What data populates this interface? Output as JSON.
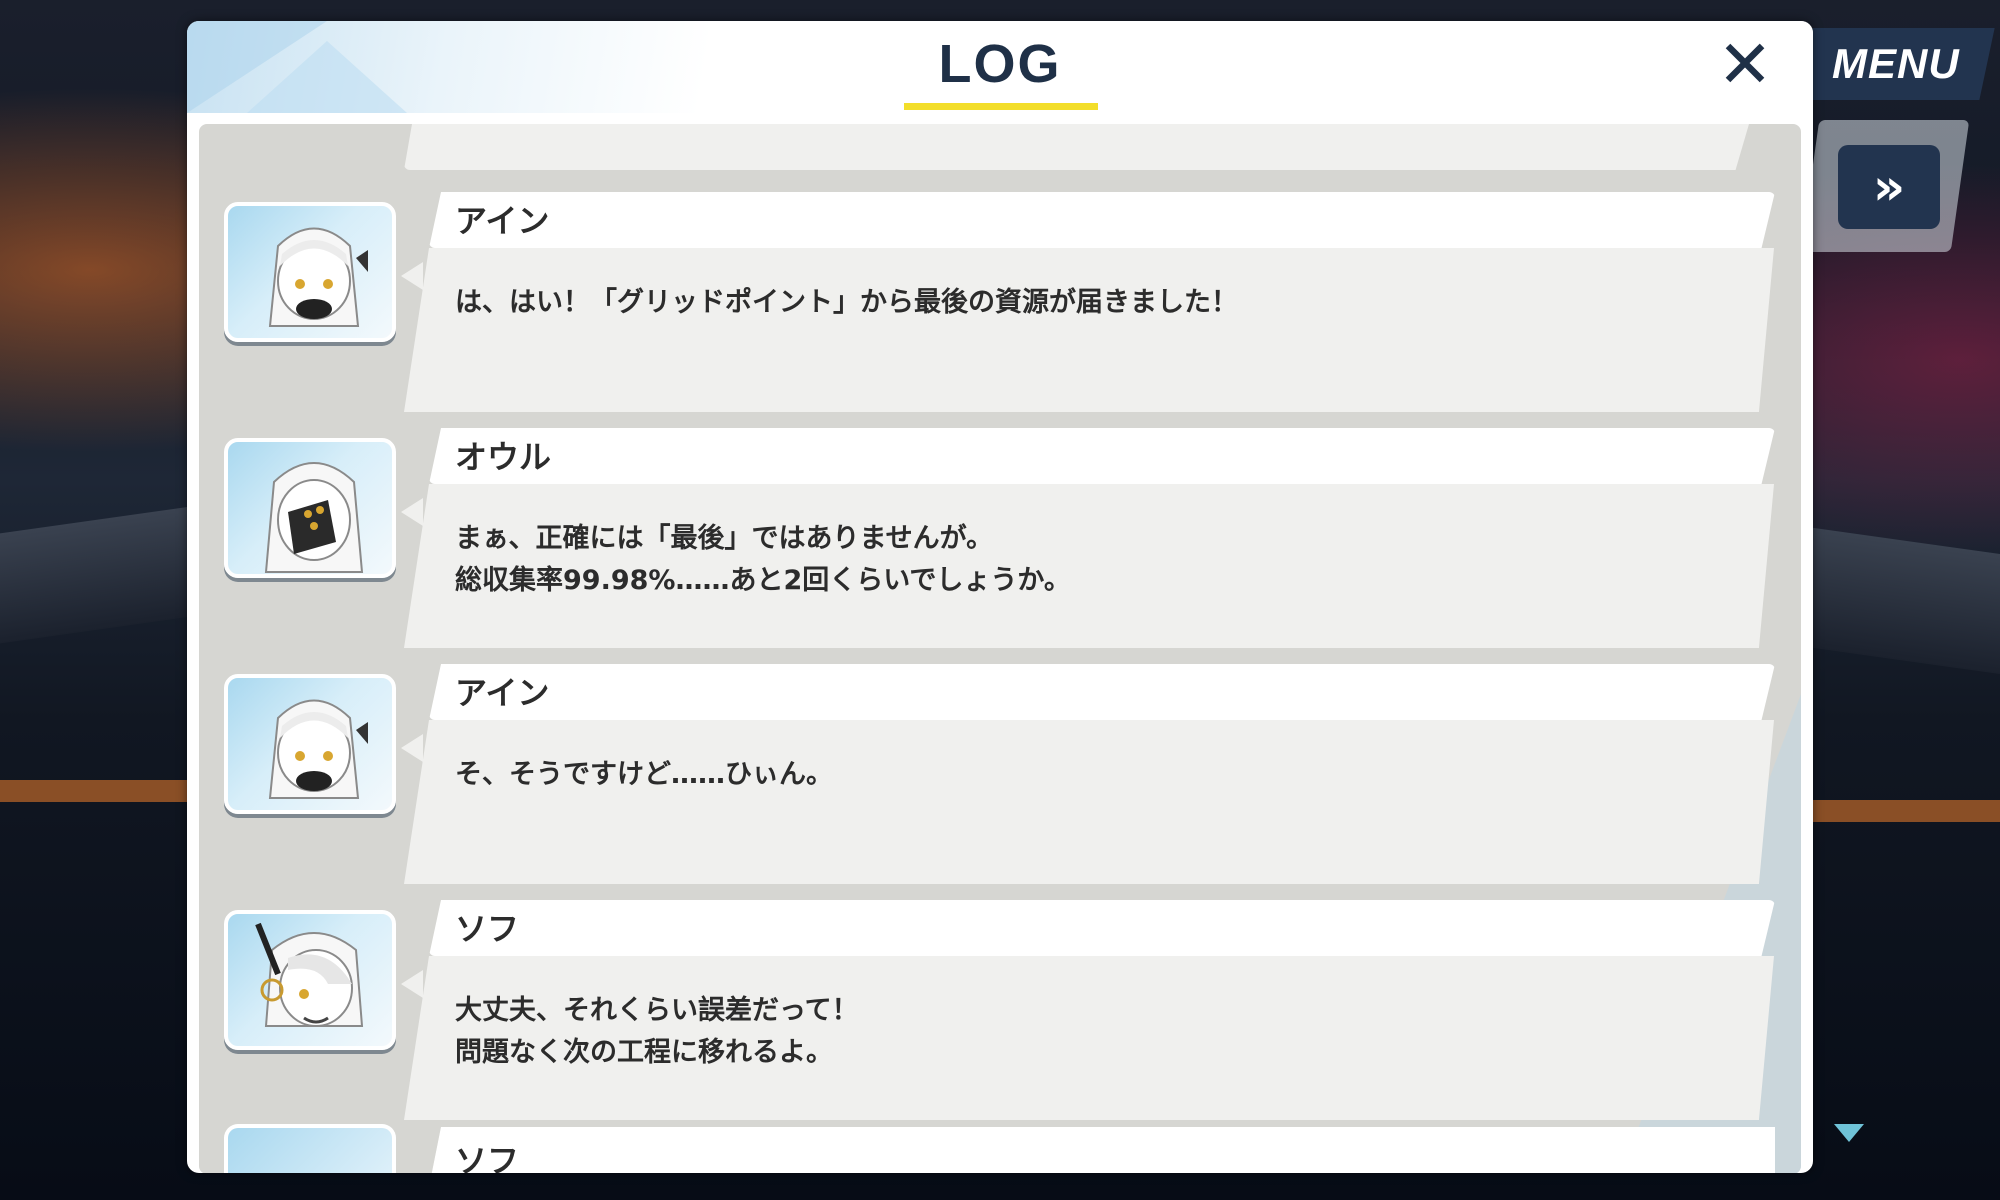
{
  "dialog": {
    "title": "LOG",
    "close_icon": "close-icon"
  },
  "hud": {
    "menu_label": "MENU",
    "skip_icon": "fast-forward-icon",
    "scroll_icon": "scroll-down-icon"
  },
  "entries": [
    {
      "speaker": "アイン",
      "portrait": "character-portrait-ain",
      "lines": [
        "は、はい！「グリッドポイント」から最後の資源が届きました！"
      ]
    },
    {
      "speaker": "オウル",
      "portrait": "character-portrait-owl",
      "lines": [
        "まぁ、正確には「最後」ではありませんが。",
        "総収集率99.98%……あと2回くらいでしょうか。"
      ]
    },
    {
      "speaker": "アイン",
      "portrait": "character-portrait-ain",
      "lines": [
        "そ、そうですけど……ひぃん。"
      ]
    },
    {
      "speaker": "ソフ",
      "portrait": "character-portrait-sof",
      "lines": [
        "大丈夫、それくらい誤差だって！",
        "問題なく次の工程に移れるよ。"
      ]
    }
  ],
  "partial_next_speaker": "ソフ",
  "colors": {
    "accent_underline": "#f3de2a",
    "dark_navy": "#22344f",
    "title_text": "#1f3047"
  }
}
